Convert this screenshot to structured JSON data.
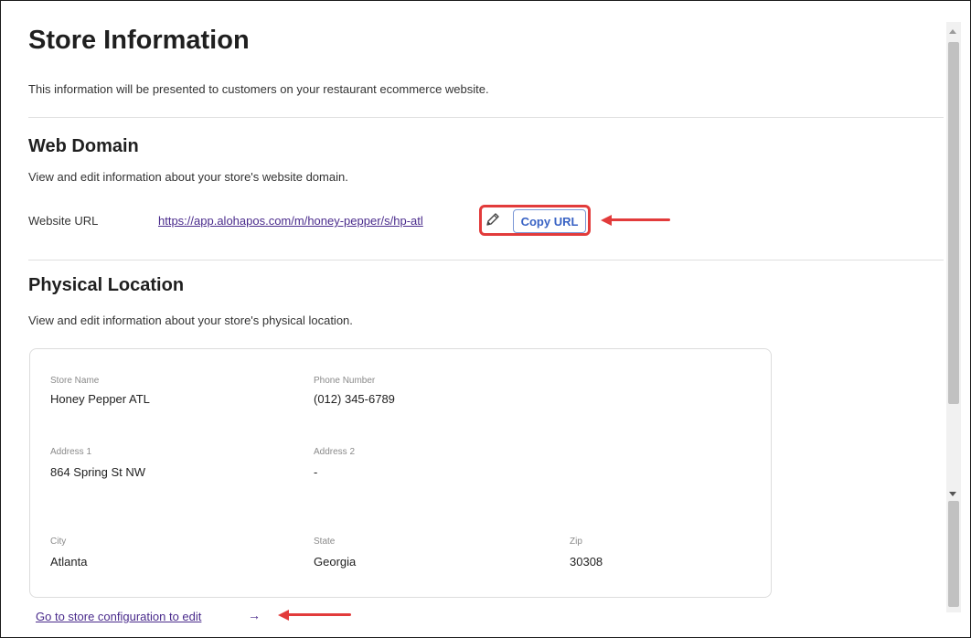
{
  "page": {
    "title": "Store Information",
    "subtitle": "This information will be presented to customers on your restaurant ecommerce website."
  },
  "web_domain": {
    "title": "Web Domain",
    "description": "View and edit information about your store's website domain.",
    "url_label": "Website URL",
    "url_value": "https://app.alohapos.com/m/honey-pepper/s/hp-atl",
    "edit_icon": "pencil-icon",
    "copy_button_label": "Copy URL"
  },
  "physical_location": {
    "title": "Physical Location",
    "description": "View and edit information about your store's physical location.",
    "store_name": {
      "label": "Store Name",
      "value": "Honey Pepper ATL"
    },
    "phone_number": {
      "label": "Phone Number",
      "value": "(012) 345-6789"
    },
    "address1": {
      "label": "Address 1",
      "value": "864 Spring St NW"
    },
    "address2": {
      "label": "Address 2",
      "value": "-"
    },
    "city": {
      "label": "City",
      "value": "Atlanta"
    },
    "state": {
      "label": "State",
      "value": "Georgia"
    },
    "zip": {
      "label": "Zip",
      "value": "30308"
    }
  },
  "footer": {
    "edit_link_label": "Go to store configuration to edit",
    "edit_link_arrow": "→"
  },
  "colors": {
    "annotation_red": "#e23b3b",
    "link_purple": "#4a2b8c",
    "button_blue": "#3862c4"
  }
}
